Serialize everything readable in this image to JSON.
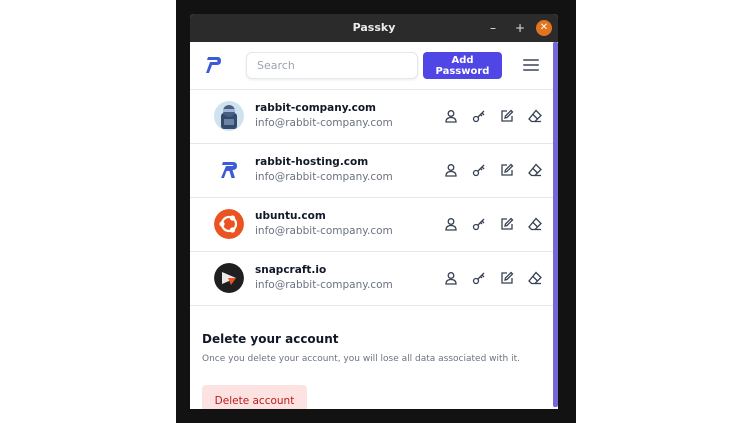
{
  "window": {
    "title": "Passky",
    "controls": {
      "minimize": "–",
      "maximize": "+",
      "close": "✕"
    }
  },
  "header": {
    "search_placeholder": "Search",
    "add_password_label": "Add Password"
  },
  "passwords": [
    {
      "website": "rabbit-company.com",
      "username": "info@rabbit-company.com",
      "icon": "rabbit-company-avatar"
    },
    {
      "website": "rabbit-hosting.com",
      "username": "info@rabbit-company.com",
      "icon": "rabbit-hosting-logo"
    },
    {
      "website": "ubuntu.com",
      "username": "info@rabbit-company.com",
      "icon": "ubuntu-logo"
    },
    {
      "website": "snapcraft.io",
      "username": "info@rabbit-company.com",
      "icon": "snapcraft-logo"
    }
  ],
  "row_actions": [
    "copy-username-icon",
    "copy-password-icon",
    "edit-icon",
    "delete-icon"
  ],
  "delete_account": {
    "title": "Delete your account",
    "description": "Once you delete your account, you will lose all data associated with it.",
    "button_label": "Delete account"
  },
  "colors": {
    "accent": "#4f46e5",
    "scrollbar": "#7468d8",
    "danger_bg": "#fde2e2",
    "danger_text": "#b91c1c",
    "titlebar": "#2b2b2b",
    "close_button": "#e2731f"
  }
}
